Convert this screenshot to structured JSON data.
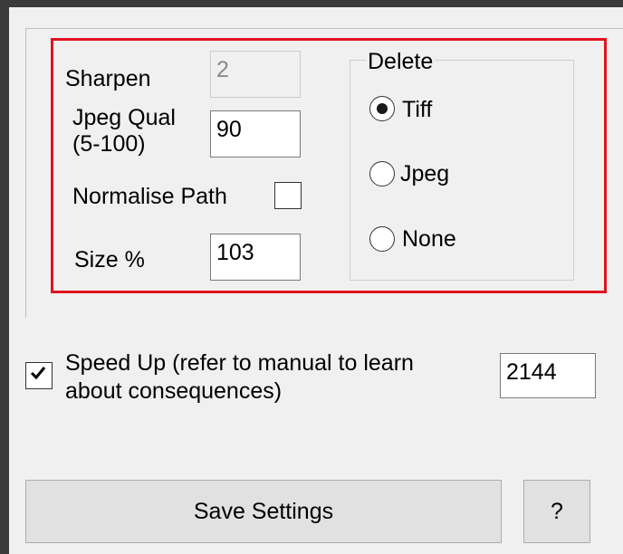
{
  "settings": {
    "sharpen_label": "Sharpen",
    "sharpen_value": "2",
    "jpeg_qual_label_1": "Jpeg Qual",
    "jpeg_qual_label_2": "(5-100)",
    "jpeg_qual_value": "90",
    "normalise_path_label": "Normalise Path",
    "normalise_path_checked": false,
    "size_label": "Size %",
    "size_value": "103"
  },
  "delete_group": {
    "title": "Delete",
    "options": [
      {
        "label": "Tiff",
        "selected": true
      },
      {
        "label": "Jpeg",
        "selected": false
      },
      {
        "label": "None",
        "selected": false
      }
    ]
  },
  "speed_up": {
    "label_1": "Speed Up (refer to manual to learn",
    "label_2": "about consequences)",
    "checked": true,
    "value": "2144"
  },
  "buttons": {
    "save_label": "Save Settings",
    "help_label": "?"
  },
  "colors": {
    "highlight": "#e0141e",
    "background": "#f0f0f0",
    "frame": "#3b3b3b"
  }
}
